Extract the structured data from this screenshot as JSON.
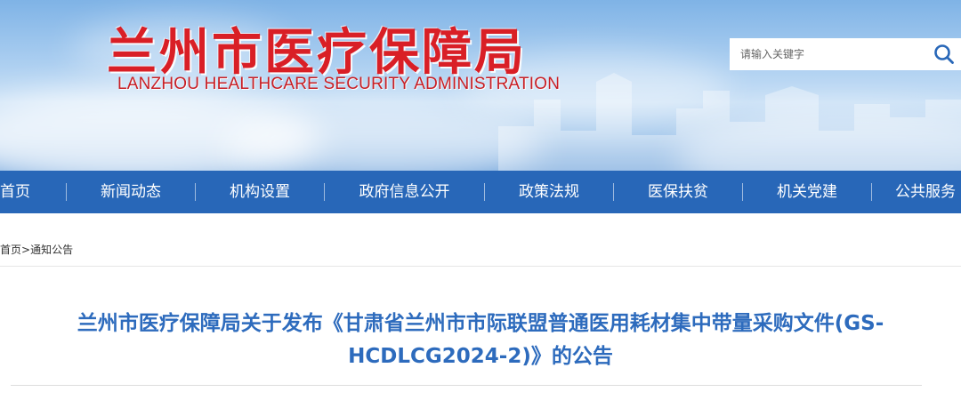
{
  "header": {
    "title_cn": "兰州市医疗保障局",
    "title_en": "LANZHOU HEALTHCARE SECURITY ADMINISTRATION"
  },
  "search": {
    "placeholder": "请输入关键字",
    "icon": "search-icon"
  },
  "nav": {
    "items": [
      {
        "label": "首页"
      },
      {
        "label": "新闻动态"
      },
      {
        "label": "机构设置"
      },
      {
        "label": "政府信息公开"
      },
      {
        "label": "政策法规"
      },
      {
        "label": "医保扶贫"
      },
      {
        "label": "机关党建"
      },
      {
        "label": "公共服务"
      }
    ]
  },
  "breadcrumb": {
    "home": "首页",
    "separator": ">",
    "current": "通知公告"
  },
  "article": {
    "title": "兰州市医疗保障局关于发布《甘肃省兰州市市际联盟普通医用耗材集中带量采购文件(GS-HCDLCG2024-2)》的公告"
  },
  "colors": {
    "brand_red": "#d91f26",
    "nav_blue": "#2867b8",
    "title_blue": "#2d6bbd"
  }
}
